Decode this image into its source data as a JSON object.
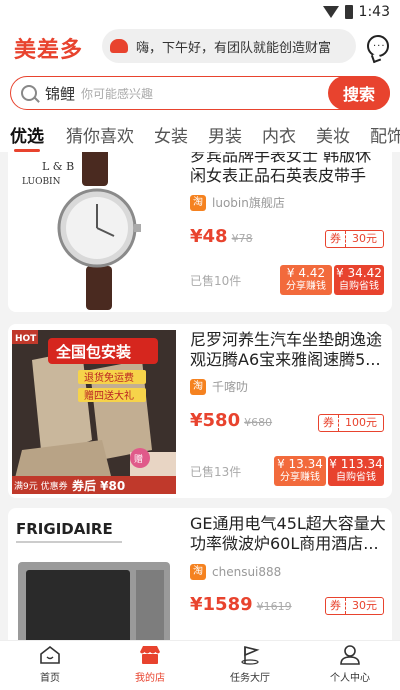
{
  "status": {
    "time": "1:43"
  },
  "header": {
    "logo": "美差多",
    "notice": "嗨，下午好，有团队就能创造财富"
  },
  "search": {
    "keyword": "锦鲤",
    "placeholder": "你可能感兴趣",
    "button": "搜索"
  },
  "tabs": [
    "优选",
    "猜你喜欢",
    "女装",
    "男装",
    "内衣",
    "美妆",
    "配饰"
  ],
  "products": [
    {
      "brand_text": "L & B\nLUOBIN",
      "title": "罗宾品牌手表女士 韩版休闲女表正品石英表皮带手表...",
      "shop": "luobin旗舰店",
      "price": "¥48",
      "original_price": "¥78",
      "coupon_label": "券",
      "coupon_value": "30元",
      "sold": "已售10件",
      "share_value": "¥ 4.42",
      "share_label": "分享赚钱",
      "self_value": "¥ 34.42",
      "self_label": "自购省钱"
    },
    {
      "badge_hot": "HOT",
      "banner": "全国包安装",
      "sub1": "退货免运费",
      "sub2": "赠四送大礼",
      "corner": "赠",
      "promo_left": "满9元 优惠券",
      "promo_right": "券后 ¥80",
      "title": "尼罗河养生汽车坐垫朗逸途观迈腾A6宝来雅阁速腾5...",
      "shop": "千喀叻",
      "price": "¥580",
      "original_price": "¥680",
      "coupon_label": "券",
      "coupon_value": "100元",
      "sold": "已售13件",
      "share_value": "¥ 13.34",
      "share_label": "分享赚钱",
      "self_value": "¥ 113.34",
      "self_label": "自购省钱"
    },
    {
      "brand_text": "FRIGIDAIRE",
      "title": "GE通用电气45L超大容量大功率微波炉60L商用酒店...",
      "shop": "chensui888",
      "price": "¥1589",
      "original_price": "¥1619",
      "coupon_label": "券",
      "coupon_value": "30元"
    }
  ],
  "nav": [
    {
      "label": "首页"
    },
    {
      "label": "我的店"
    },
    {
      "label": "任务大厅"
    },
    {
      "label": "个人中心"
    }
  ],
  "colors": {
    "accent": "#e8432e",
    "taobao": "#f58220"
  }
}
